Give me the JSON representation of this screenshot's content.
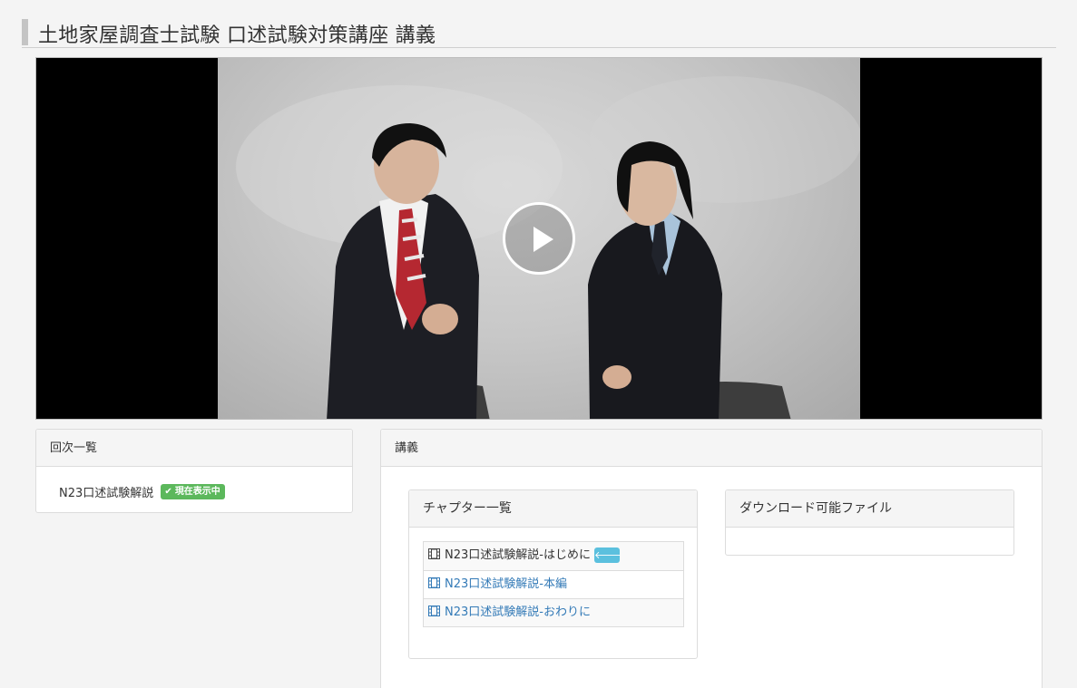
{
  "page": {
    "title": "土地家屋調査士試験 口述試験対策講座 講義"
  },
  "video": {
    "play_icon": "play-icon"
  },
  "sessions": {
    "heading": "回次一覧",
    "items": [
      {
        "label": "N23口述試験解説",
        "badge": "現在表示中",
        "badge_icon": "check-icon"
      }
    ]
  },
  "lecture": {
    "heading": "講義",
    "chapters": {
      "heading": "チャプター一覧",
      "items": [
        {
          "label": "N23口述試験解説-はじめに",
          "icon": "film-icon",
          "current": true,
          "indicator": "arrow-left-icon"
        },
        {
          "label": "N23口述試験解説-本編",
          "icon": "film-icon",
          "current": false
        },
        {
          "label": "N23口述試験解説-おわりに",
          "icon": "film-icon",
          "current": false
        }
      ]
    },
    "downloads": {
      "heading": "ダウンロード可能ファイル"
    }
  },
  "colors": {
    "accent_link": "#337ab7",
    "badge_success": "#5cb85c",
    "badge_info": "#5bc0de",
    "header_bar": "#c4c4c4"
  }
}
